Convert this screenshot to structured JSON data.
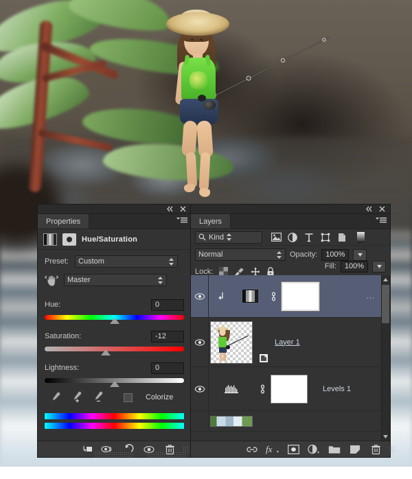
{
  "app": "Adobe Photoshop",
  "canvas": {
    "description": "Blurred nature photo with blurred green leaves and red stem at left, dark rocks in middle, flowing white water at bottom",
    "subject": "cut-out photo of a girl wearing a straw hat, green tank top and denim shorts, sitting and holding a fishing rod"
  },
  "properties_panel": {
    "tab_label": "Properties",
    "title": "Hue/Saturation",
    "collapse_icon": "collapse-double-arrow-icon",
    "close_icon": "close-icon",
    "menu_icon": "panel-menu-icon",
    "adjustment_thumb_icon": "hue-saturation-adjustment-icon",
    "clip_icon": "clip-to-layer-icon",
    "preset_label": "Preset:",
    "preset_value": "Custom",
    "hand_icon": "on-image-adjust-hand-icon",
    "channel_value": "Master",
    "sliders": [
      {
        "label": "Hue:",
        "value": "0",
        "track": "hue",
        "thumb_pct": 50
      },
      {
        "label": "Saturation:",
        "value": "-12",
        "track": "sat",
        "thumb_pct": 44
      },
      {
        "label": "Lightness:",
        "value": "0",
        "track": "lig",
        "thumb_pct": 50
      }
    ],
    "eyedroppers": [
      {
        "name": "eyedropper-icon"
      },
      {
        "name": "eyedropper-add-icon"
      },
      {
        "name": "eyedropper-subtract-icon"
      }
    ],
    "colorize_label": "Colorize",
    "colorize_checked": false,
    "footer_buttons": [
      {
        "name": "clip-to-layer-button",
        "icon": "clip-to-layer-icon"
      },
      {
        "name": "toggle-previous-state-button",
        "icon": "eye-cycle-icon"
      },
      {
        "name": "reset-button",
        "icon": "reset-arrow-icon"
      },
      {
        "name": "toggle-visibility-button",
        "icon": "eye-icon"
      },
      {
        "name": "delete-adjustment-button",
        "icon": "trash-icon"
      }
    ]
  },
  "layers_panel": {
    "tab_label": "Layers",
    "collapse_icon": "collapse-double-arrow-icon",
    "close_icon": "close-icon",
    "menu_icon": "panel-menu-icon",
    "filter": {
      "search_icon": "search-icon",
      "kind_value": "Kind",
      "icons": [
        {
          "name": "filter-pixel-layers-icon"
        },
        {
          "name": "filter-adjustment-layers-icon"
        },
        {
          "name": "filter-type-layers-icon"
        },
        {
          "name": "filter-shape-layers-icon"
        },
        {
          "name": "filter-smart-object-layers-icon"
        },
        {
          "name": "filter-toggle-switch-icon"
        }
      ]
    },
    "blend_mode": "Normal",
    "opacity_label": "Opacity:",
    "opacity_value": "100%",
    "fill_label": "Fill:",
    "fill_value": "100%",
    "lock_label": "Lock:",
    "lock_icons": [
      {
        "name": "lock-transparent-pixels-icon"
      },
      {
        "name": "lock-image-pixels-icon"
      },
      {
        "name": "lock-position-icon"
      },
      {
        "name": "lock-all-icon"
      }
    ],
    "rows": [
      {
        "visible": true,
        "selected": true,
        "clip_indicator": "clipping-mask-arrow-icon",
        "thumb_type": "adjustment",
        "link_icon": "link-mask-icon",
        "mask": "white-layer-mask",
        "name": "",
        "overflow": "..."
      },
      {
        "visible": true,
        "selected": false,
        "thumb_type": "transparent-photo",
        "name": "Layer 1",
        "badge": "smart-object-badge-icon"
      },
      {
        "visible": true,
        "selected": false,
        "thumb_type": "levels-histogram",
        "link_icon": "link-mask-icon",
        "mask": "white-layer-mask",
        "name": "Levels 1"
      },
      {
        "visible": true,
        "selected": false,
        "thumb_type": "background-photo",
        "name": ""
      }
    ],
    "scrollbar": {
      "up_arrow": "scroll-up-arrow-icon",
      "down_arrow": "scroll-down-arrow-icon"
    },
    "footer_buttons": [
      {
        "name": "link-layers-button",
        "icon": "link-icon"
      },
      {
        "name": "layer-style-button",
        "icon": "fx-icon"
      },
      {
        "name": "add-layer-mask-button",
        "icon": "mask-icon"
      },
      {
        "name": "new-adjustment-layer-button",
        "icon": "half-circle-icon"
      },
      {
        "name": "new-group-button",
        "icon": "folder-icon"
      },
      {
        "name": "new-layer-button",
        "icon": "new-layer-icon"
      },
      {
        "name": "delete-layer-button",
        "icon": "trash-icon"
      }
    ]
  }
}
